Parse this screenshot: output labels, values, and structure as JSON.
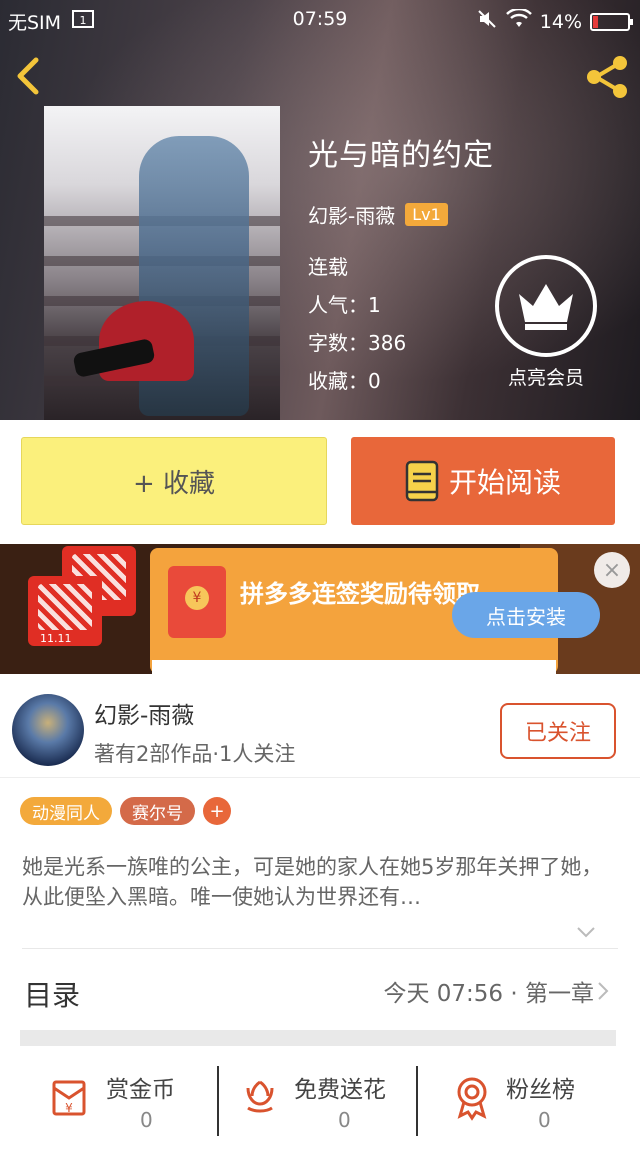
{
  "status_bar": {
    "carrier": "无SIM",
    "time": "07:59",
    "battery": "14%",
    "battery_level": 0.14
  },
  "book": {
    "title": "光与暗的约定",
    "author": "幻影-雨薇",
    "level": "Lv1",
    "status": "连载",
    "popularity": "人气：1",
    "word_count": "字数：386",
    "favorites": "收藏：0"
  },
  "vip": {
    "label": "点亮会员"
  },
  "actions": {
    "favorite_label": "+ 收藏",
    "read_label": "开始阅读"
  },
  "ad": {
    "text": "拼多多连签奖励待领取",
    "install_label": "点击安装",
    "close_label": "×",
    "logo_tag": "11.11",
    "envelope_symbol": "¥"
  },
  "author_section": {
    "name": "幻影-雨薇",
    "stats": "著有2部作品·1人关注",
    "follow_label": "已关注"
  },
  "tags": [
    "动漫同人",
    "赛尔号"
  ],
  "tag_add_label": "+",
  "synopsis": "她是光系一族唯的公主，可是她的家人在她5岁那年关押了她，从此便坠入黑暗。唯一使她认为世界还有…",
  "toc": {
    "title": "目录",
    "latest": "今天 07:56 · 第一章"
  },
  "bottom_bar": {
    "reward": {
      "label": "赏金币",
      "count": "0"
    },
    "flowers": {
      "label": "免费送花",
      "count": "0"
    },
    "fans": {
      "label": "粉丝榜",
      "count": "0"
    }
  },
  "colors": {
    "accent_orange": "#e8673a",
    "favorite_yellow": "#fbf07c",
    "level_badge": "#f3a93b",
    "follow_red": "#d9532e"
  }
}
